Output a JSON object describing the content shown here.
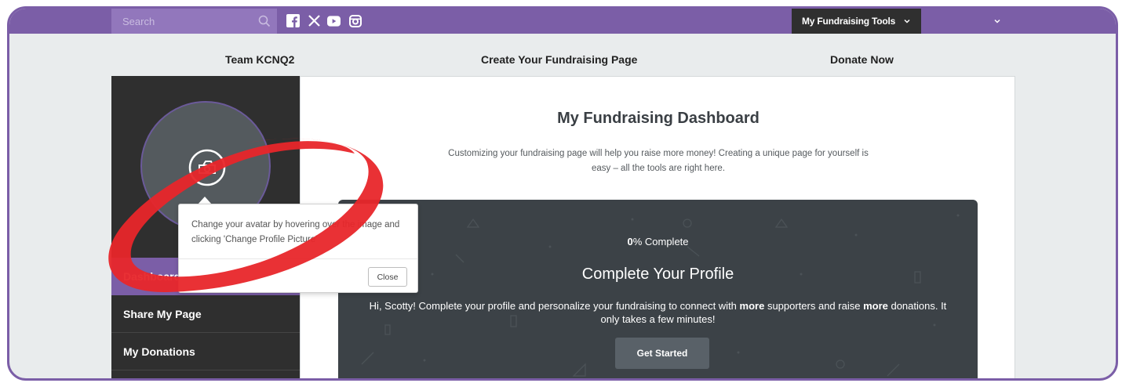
{
  "topbar": {
    "search_placeholder": "Search",
    "social_icons": [
      "facebook-icon",
      "x-icon",
      "youtube-icon",
      "instagram-icon"
    ],
    "tools_label": "My Fundraising Tools"
  },
  "nav": {
    "team": "Team KCNQ2",
    "create": "Create Your Fundraising Page",
    "donate": "Donate Now"
  },
  "sidebar": {
    "items": [
      {
        "label": "Dashboard"
      },
      {
        "label": "Share My Page"
      },
      {
        "label": "My Donations"
      }
    ]
  },
  "main": {
    "title": "My Fundraising Dashboard",
    "description": "Customizing your fundraising page will help you raise more money! Creating a unique page for yourself is easy – all the tools are right here."
  },
  "profile_card": {
    "percent": "0",
    "percent_suffix": "% Complete",
    "title": "Complete Your Profile",
    "body_1": "Hi, Scotty! Complete your profile and personalize your fundraising to connect with ",
    "body_bold_1": "more",
    "body_2": " supporters and raise ",
    "body_bold_2": "more",
    "body_3": " donations. It only takes a few minutes!",
    "button": "Get Started"
  },
  "tooltip": {
    "text": "Change your avatar by hovering over the image and clicking 'Change Profile Picture'",
    "close": "Close"
  },
  "colors": {
    "brand_purple": "#7b5ea7",
    "dark": "#2f2f2f",
    "card": "#3c4247",
    "annotation_red": "#e8262a"
  }
}
